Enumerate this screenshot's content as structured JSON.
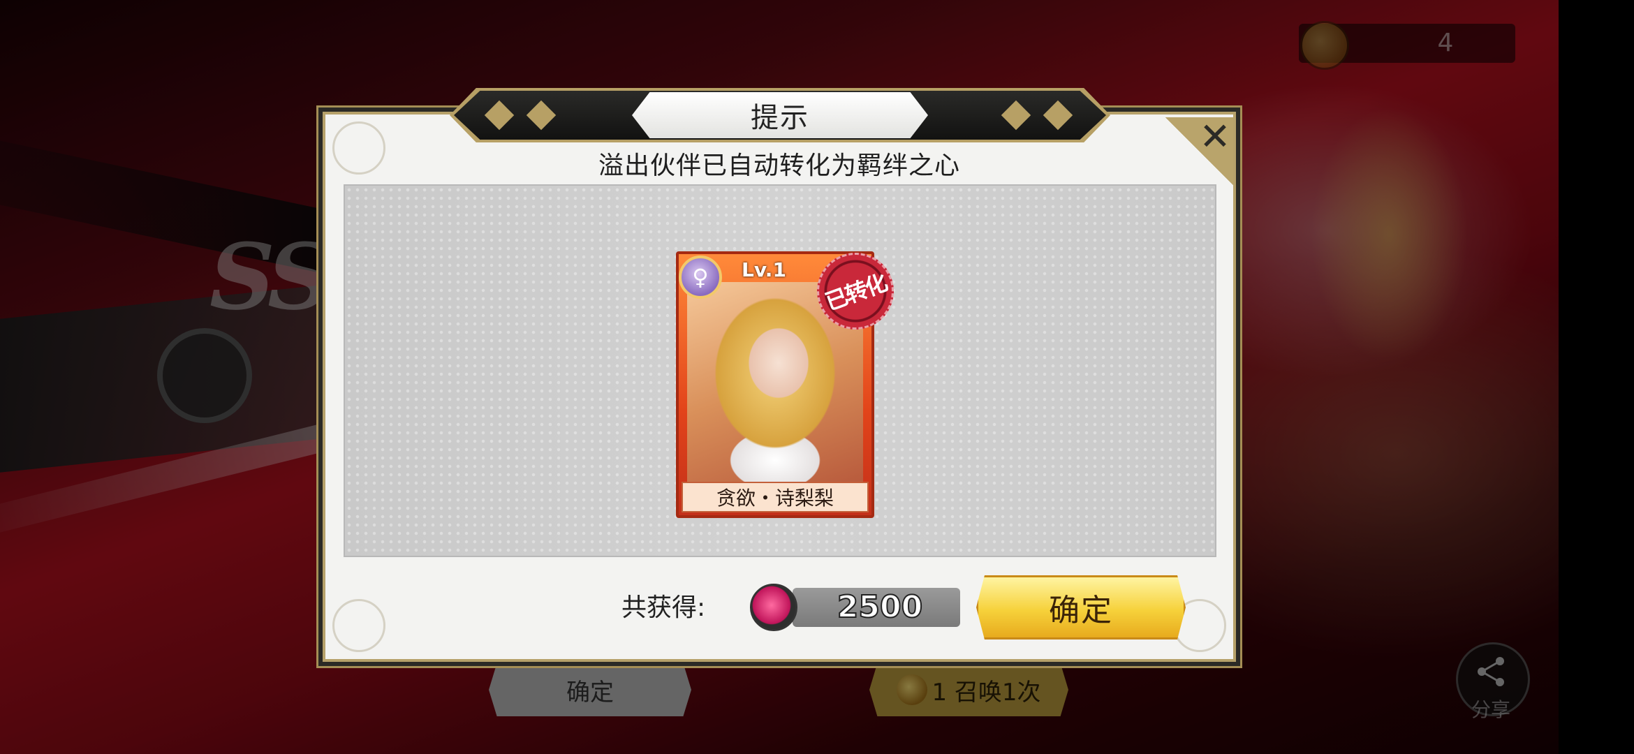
{
  "background": {
    "top_right_currency_count": "4",
    "bottom_buttons": {
      "confirm_label": "确定",
      "summon_label": "1 召唤1次"
    },
    "share_label": "分享",
    "banner_partial_text": "SS"
  },
  "dialog": {
    "title": "提示",
    "message": "溢出伙伴已自动转化为羁绊之心",
    "card": {
      "level": "Lv.1",
      "name": "贪欲・诗梨梨",
      "stamp": "已转化",
      "frame_color": "#e2441a"
    },
    "total_label": "共获得:",
    "total_value": "2500",
    "confirm_label": "确定",
    "close_icon": "close-icon"
  },
  "colors": {
    "accent_gold": "#b7a065",
    "confirm_yellow": "#f6d13a",
    "heart_pink": "#ff6aa0"
  }
}
